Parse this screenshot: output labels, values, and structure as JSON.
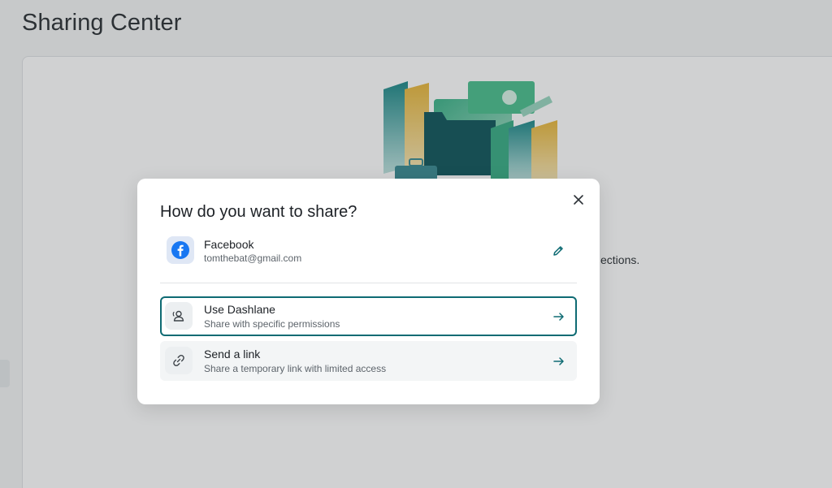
{
  "page": {
    "title": "Sharing Center",
    "background_text": "ections."
  },
  "modal": {
    "title": "How do you want to share?",
    "account": {
      "name": "Facebook",
      "email": "tomthebat@gmail.com",
      "icon": "facebook-icon"
    },
    "options": [
      {
        "title": "Use Dashlane",
        "subtitle": "Share with specific permissions",
        "icon": "user-group-icon",
        "selected": true
      },
      {
        "title": "Send a link",
        "subtitle": "Share a temporary link with limited access",
        "icon": "link-icon",
        "selected": false
      }
    ]
  },
  "colors": {
    "accent": "#0e6b73",
    "facebook": "#1877f2",
    "overlay": "rgba(40,45,50,0.22)"
  }
}
